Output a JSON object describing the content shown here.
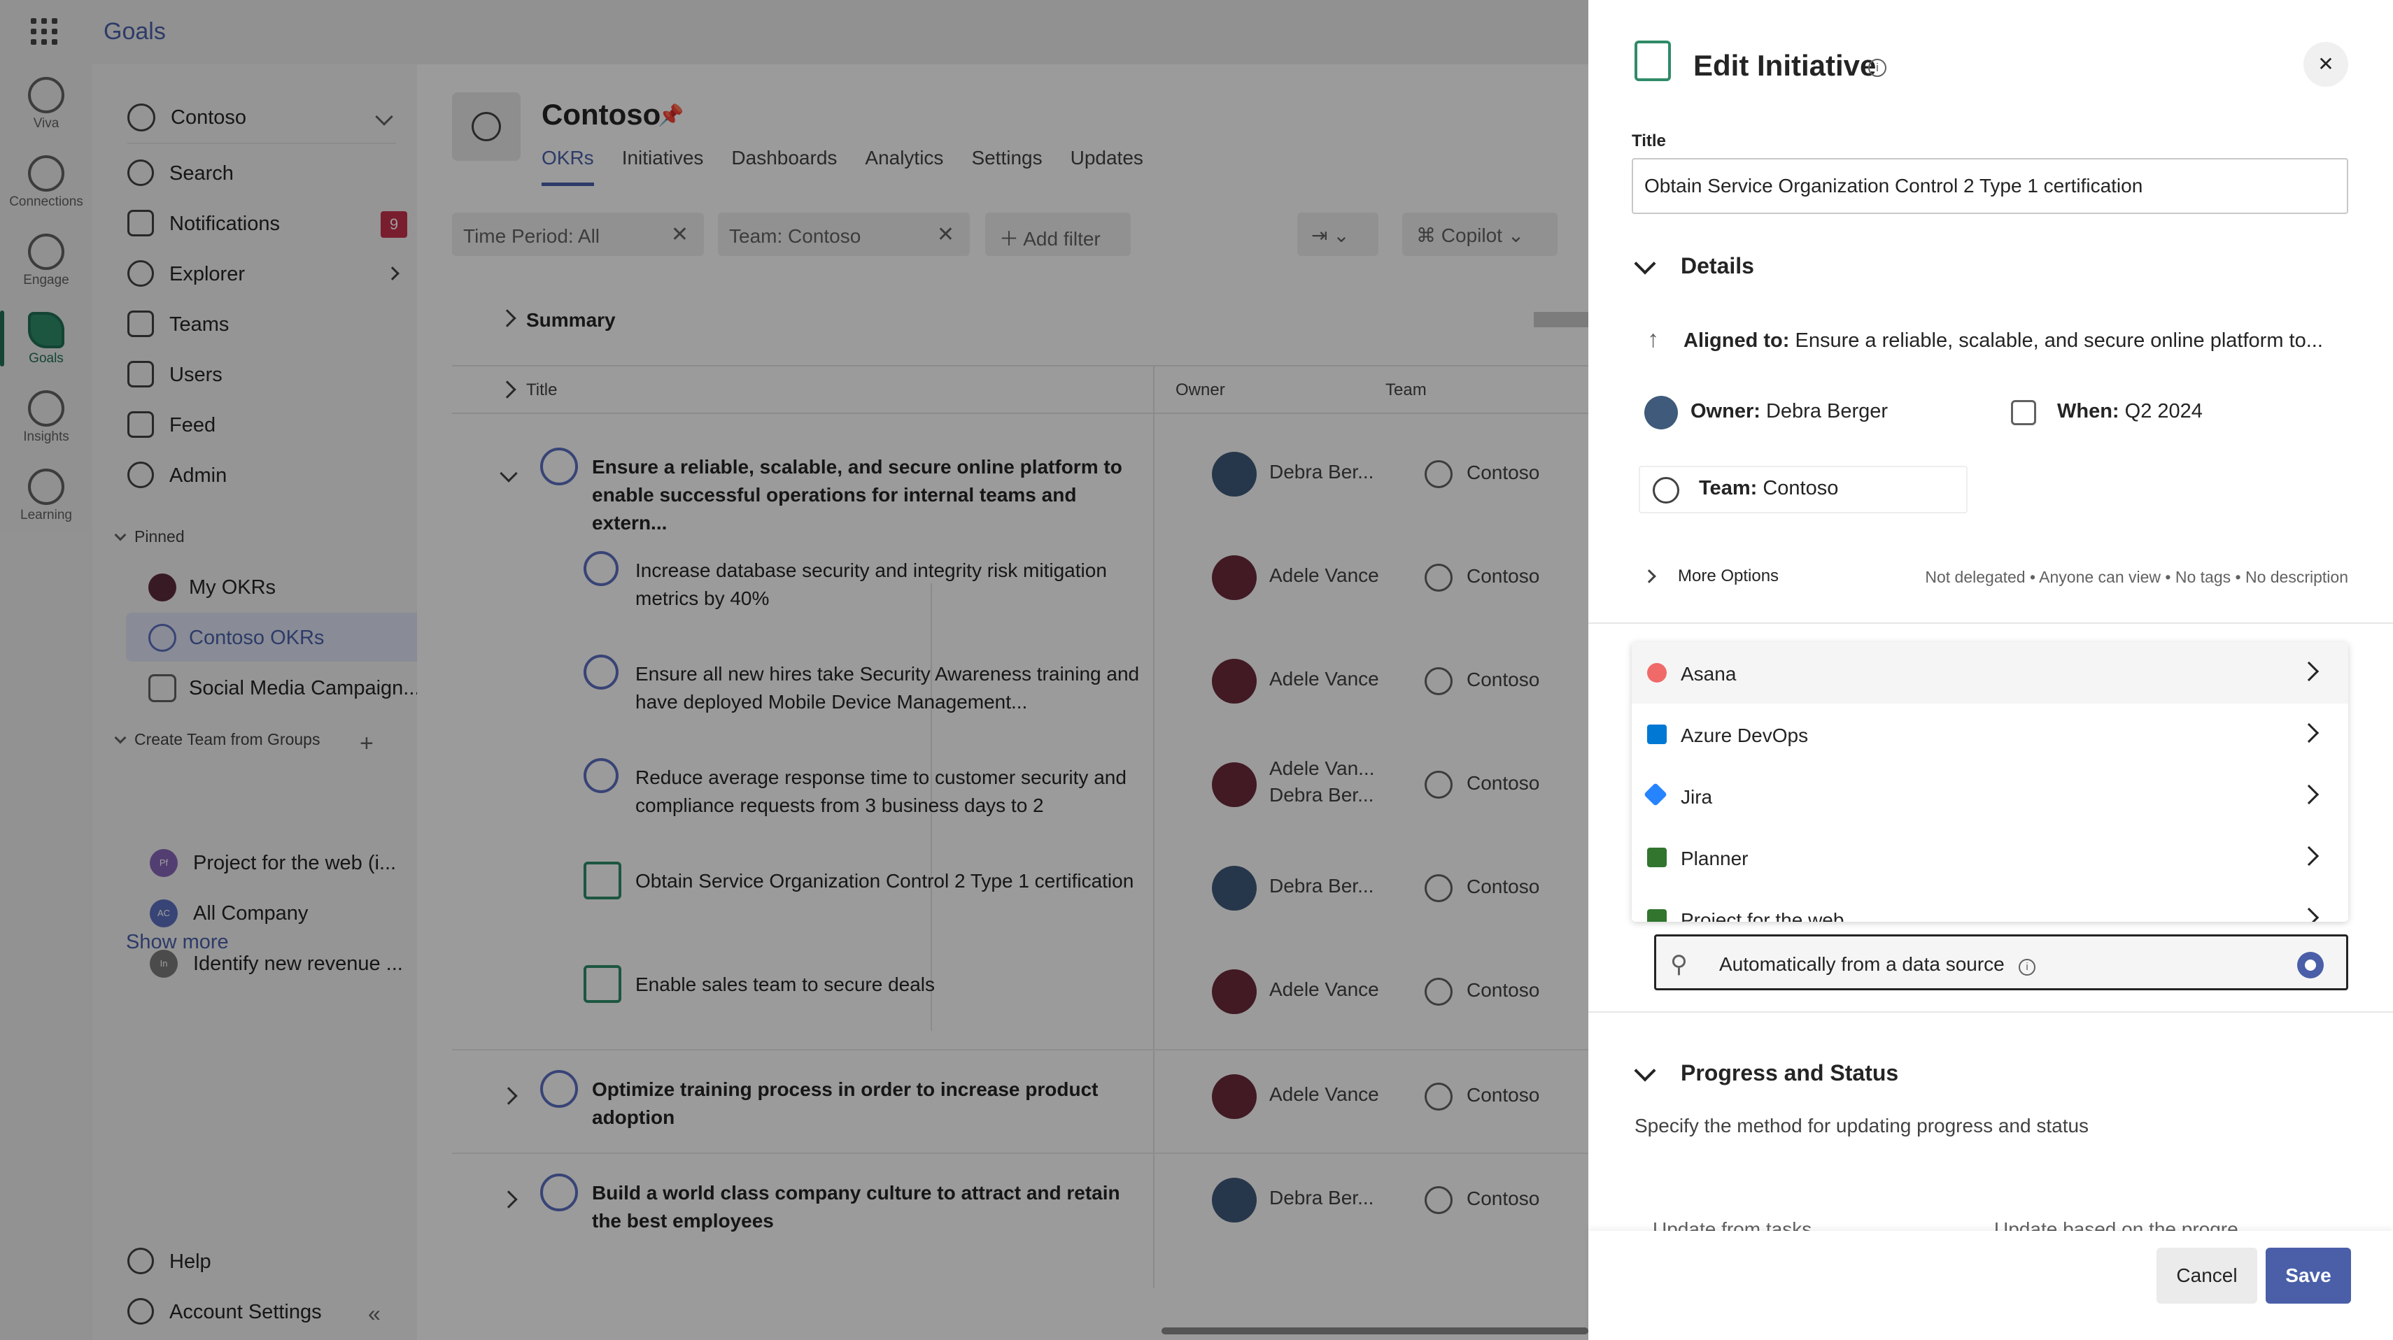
{
  "app": {
    "title": "Goals"
  },
  "rail": [
    {
      "label": "Viva",
      "icon": "viva-icon"
    },
    {
      "label": "Connections",
      "icon": "connections-icon"
    },
    {
      "label": "Engage",
      "icon": "engage-icon"
    },
    {
      "label": "Goals",
      "icon": "goals-icon",
      "active": true
    },
    {
      "label": "Insights",
      "icon": "insights-icon"
    },
    {
      "label": "Learning",
      "icon": "learning-icon"
    }
  ],
  "nav": {
    "org": "Contoso",
    "items": [
      {
        "label": "Search",
        "icon": "search-icon"
      },
      {
        "label": "Notifications",
        "icon": "bell-icon",
        "badge": "9"
      },
      {
        "label": "Explorer",
        "icon": "explorer-icon"
      },
      {
        "label": "Teams",
        "icon": "teams-icon"
      },
      {
        "label": "Users",
        "icon": "users-icon"
      },
      {
        "label": "Feed",
        "icon": "feed-icon"
      },
      {
        "label": "Admin",
        "icon": "gear-icon"
      }
    ],
    "pinned_label": "Pinned",
    "pinned": [
      {
        "label": "My OKRs"
      },
      {
        "label": "Contoso OKRs",
        "selected": true
      },
      {
        "label": "Social Media Campaign..."
      }
    ],
    "groups_label": "Create Team from Groups",
    "groups": [
      {
        "label": "Project for the web (i...",
        "initials": "Pf",
        "color": "#8764b8"
      },
      {
        "label": "All Company",
        "initials": "AC",
        "color": "#5b6fbf"
      },
      {
        "label": "Identify new revenue ...",
        "initials": "In",
        "color": "#7a7a7a"
      }
    ],
    "show_more": "Show more",
    "help": "Help",
    "account_settings": "Account Settings"
  },
  "main": {
    "title": "Contoso",
    "tabs": [
      "OKRs",
      "Initiatives",
      "Dashboards",
      "Analytics",
      "Settings",
      "Updates"
    ],
    "filters": {
      "time_period": "Time Period: All",
      "team": "Team:  Contoso",
      "add_filter": "Add filter",
      "copilot": "Copilot"
    },
    "summary": "Summary",
    "columns": {
      "title": "Title",
      "owner": "Owner",
      "team": "Team"
    },
    "rows": [
      {
        "title": "Ensure a reliable, scalable, and secure online platform to enable successful operations for internal teams and extern...",
        "owner": "Debra Ber...",
        "team": "Contoso"
      },
      {
        "title": "Increase database security and integrity risk mitigation metrics by 40%",
        "owner": "Adele Vance",
        "team": "Contoso"
      },
      {
        "title": "Ensure all new hires take Security Awareness training and have deployed Mobile Device Management...",
        "owner": "Adele Vance",
        "team": "Contoso"
      },
      {
        "title": "Reduce average response time to customer security and compliance requests from 3 business days to 2",
        "owner": "Adele Van...\nDebra Ber...",
        "team": "Contoso"
      },
      {
        "title": "Obtain Service Organization Control 2 Type 1 certification",
        "owner": "Debra Ber...",
        "team": "Contoso"
      },
      {
        "title": "Enable sales team to secure deals",
        "owner": "Adele Vance",
        "team": "Contoso"
      },
      {
        "title": "Optimize training process in order to increase product adoption",
        "owner": "Adele Vance",
        "team": "Contoso"
      },
      {
        "title": "Build a world class company culture to attract and retain the best employees",
        "owner": "Debra Ber...",
        "team": "Contoso"
      }
    ]
  },
  "panel": {
    "title": "Edit Initiative",
    "title_label": "Title",
    "title_value": "Obtain Service Organization Control 2 Type 1 certification",
    "details": "Details",
    "aligned_label": "Aligned to:",
    "aligned_value": " Ensure a reliable, scalable, and secure online platform to...",
    "owner_label": "Owner:",
    "owner_value": " Debra Berger",
    "when_label": "When:",
    "when_value": " Q2 2024",
    "team_label": "Team:",
    "team_value": " Contoso",
    "more_options": "More Options",
    "more_meta": "Not delegated • Anyone can view • No tags • No description",
    "datasources": [
      {
        "label": "Asana",
        "color": "#f06a6a"
      },
      {
        "label": "Azure DevOps",
        "color": "#0078d4"
      },
      {
        "label": "Jira",
        "color": "#2684ff"
      },
      {
        "label": "Planner",
        "color": "#31752f"
      },
      {
        "label": "Project for the web",
        "color": "#31752f"
      }
    ],
    "auto_label": "Automatically from a data source",
    "progress_status": "Progress and Status",
    "progress_desc": "Specify the method for updating progress and status",
    "dd_left": "Update from tasks",
    "dd_right": "Update based on the progre",
    "cancel": "Cancel",
    "save": "Save"
  }
}
